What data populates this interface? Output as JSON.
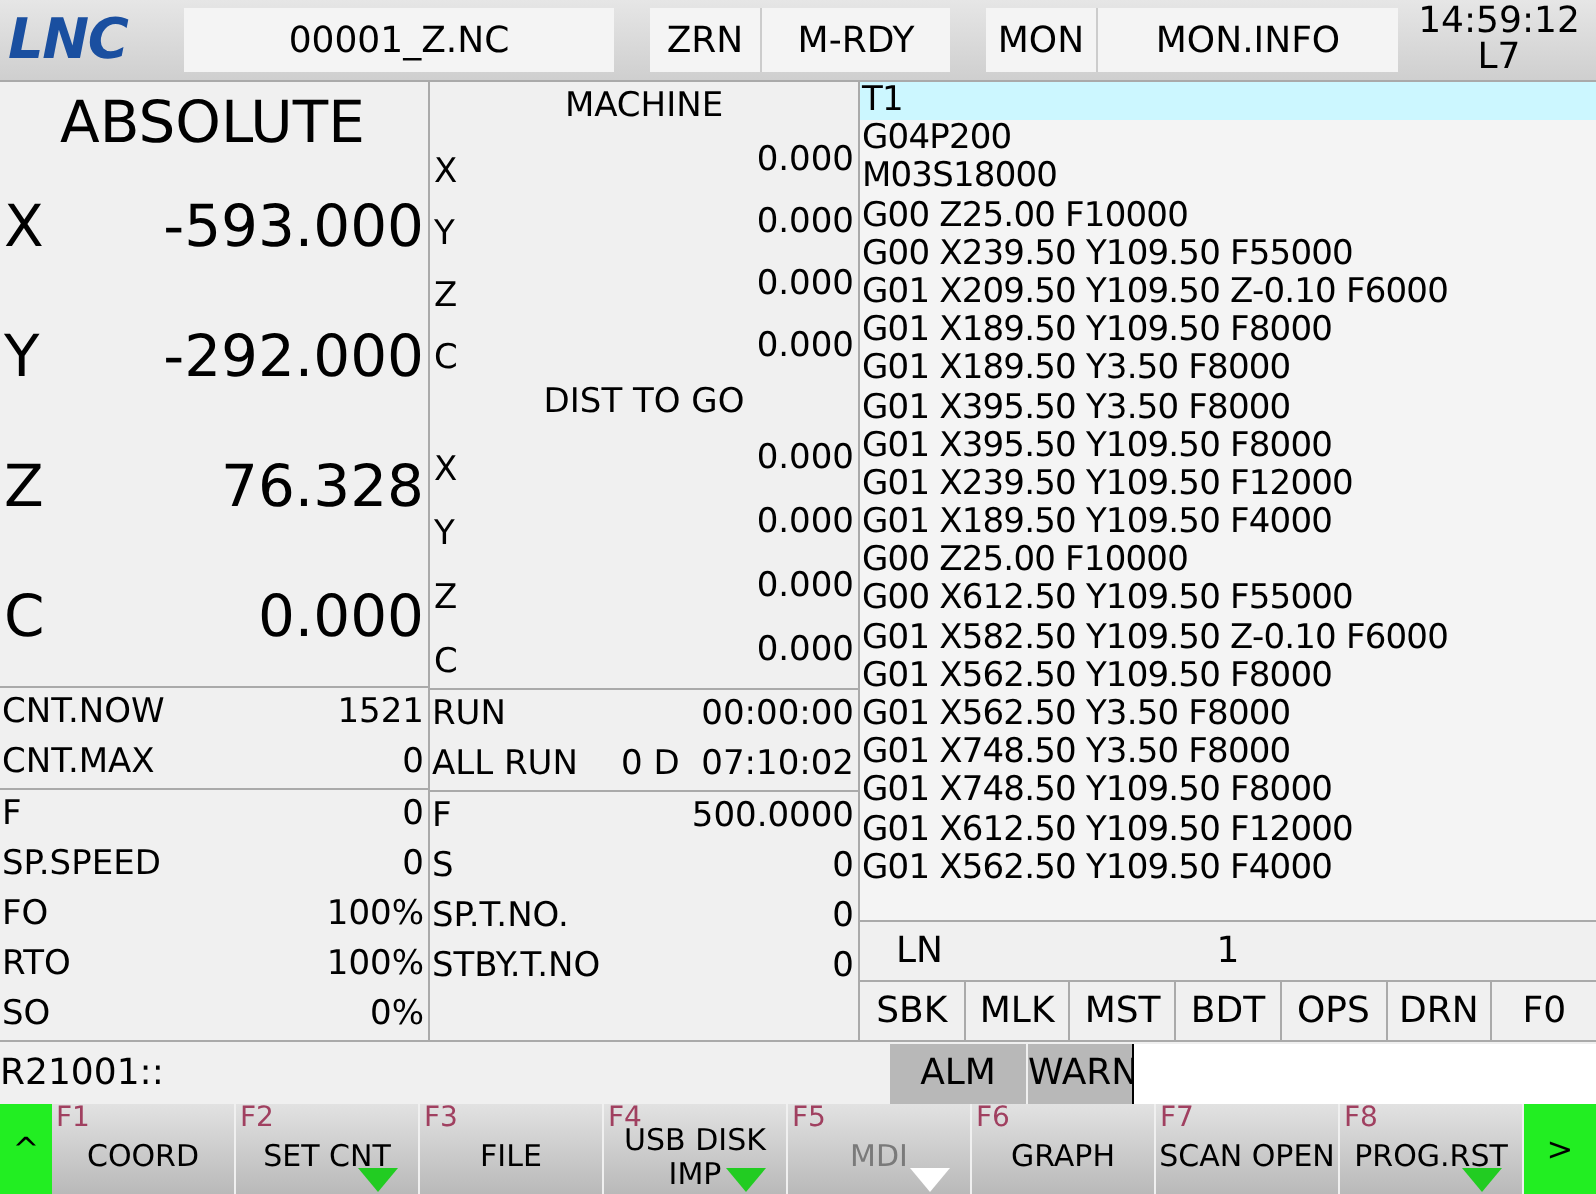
{
  "header": {
    "logo": "LNC",
    "file": "00001_Z.NC",
    "mode": [
      "ZRN",
      "M-RDY"
    ],
    "monitor": [
      "MON",
      "MON.INFO"
    ],
    "time": "14:59:12",
    "level": "L7"
  },
  "absolute": {
    "title": "ABSOLUTE",
    "axes": [
      {
        "name": "X",
        "value": "-593.000"
      },
      {
        "name": "Y",
        "value": "-292.000"
      },
      {
        "name": "Z",
        "value": "76.328"
      },
      {
        "name": "C",
        "value": "0.000"
      }
    ]
  },
  "machine": {
    "title": "MACHINE",
    "axes": [
      {
        "name": "X",
        "value": "0.000"
      },
      {
        "name": "Y",
        "value": "0.000"
      },
      {
        "name": "Z",
        "value": "0.000"
      },
      {
        "name": "C",
        "value": "0.000"
      }
    ]
  },
  "dist_to_go": {
    "title": "DIST TO GO",
    "axes": [
      {
        "name": "X",
        "value": "0.000"
      },
      {
        "name": "Y",
        "value": "0.000"
      },
      {
        "name": "Z",
        "value": "0.000"
      },
      {
        "name": "C",
        "value": "0.000"
      }
    ]
  },
  "left_stats": [
    [
      {
        "label": "CNT.NOW",
        "value": "1521"
      },
      {
        "label": "CNT.MAX",
        "value": "0"
      }
    ],
    [
      {
        "label": "F",
        "value": "0"
      },
      {
        "label": "SP.SPEED",
        "value": "0"
      },
      {
        "label": "FO",
        "value": "100%"
      },
      {
        "label": "RTO",
        "value": "100%"
      },
      {
        "label": "SO",
        "value": "0%"
      }
    ]
  ],
  "right_stats": [
    [
      {
        "label": "RUN",
        "value": "00:00:00"
      },
      {
        "label": "ALL RUN",
        "value": "0 D  07:10:02"
      }
    ],
    [
      {
        "label": "F",
        "value": "500.0000"
      },
      {
        "label": "S",
        "value": "0"
      },
      {
        "label": "SP.T.NO.",
        "value": "0"
      },
      {
        "label": "STBY.T.NO",
        "value": "0"
      }
    ]
  ],
  "program": [
    {
      "text": "T1",
      "selected": true
    },
    {
      "text": "G04P200",
      "selected": false
    },
    {
      "text": "M03S18000",
      "selected": false
    },
    {
      "text": "G00 Z25.00 F10000",
      "selected": false
    },
    {
      "text": "G00 X239.50 Y109.50 F55000",
      "selected": false
    },
    {
      "text": "G01 X209.50 Y109.50 Z-0.10 F6000",
      "selected": false
    },
    {
      "text": "G01 X189.50 Y109.50 F8000",
      "selected": false
    },
    {
      "text": "G01 X189.50 Y3.50 F8000",
      "selected": false
    },
    {
      "text": "G01 X395.50 Y3.50 F8000",
      "selected": false
    },
    {
      "text": "G01 X395.50 Y109.50 F8000",
      "selected": false
    },
    {
      "text": "G01 X239.50 Y109.50 F12000",
      "selected": false
    },
    {
      "text": "G01 X189.50 Y109.50 F4000",
      "selected": false
    },
    {
      "text": "G00 Z25.00 F10000",
      "selected": false
    },
    {
      "text": "G00 X612.50 Y109.50 F55000",
      "selected": false
    },
    {
      "text": "G01 X582.50 Y109.50 Z-0.10 F6000",
      "selected": false
    },
    {
      "text": "G01 X562.50 Y109.50 F8000",
      "selected": false
    },
    {
      "text": "G01 X562.50 Y3.50 F8000",
      "selected": false
    },
    {
      "text": "G01 X748.50 Y3.50 F8000",
      "selected": false
    },
    {
      "text": "G01 X748.50 Y109.50 F8000",
      "selected": false
    },
    {
      "text": "G01 X612.50 Y109.50 F12000",
      "selected": false
    },
    {
      "text": "G01 X562.50 Y109.50 F4000",
      "selected": false
    }
  ],
  "line_number": {
    "label": "LN",
    "value": "1"
  },
  "toggles": [
    "SBK",
    "MLK",
    "MST",
    "BDT",
    "OPS",
    "DRN",
    "F0"
  ],
  "command": {
    "text": "R21001::",
    "buttons": [
      "ALM",
      "WARN"
    ]
  },
  "softkeys": {
    "prev": "^",
    "next": ">",
    "keys": [
      {
        "fkey": "F1",
        "label": "COORD",
        "menu": false,
        "disabled": false
      },
      {
        "fkey": "F2",
        "label": "SET CNT",
        "menu": true,
        "disabled": false
      },
      {
        "fkey": "F3",
        "label": "FILE",
        "menu": false,
        "disabled": false
      },
      {
        "fkey": "F4",
        "label": "USB DISK IMP",
        "menu": true,
        "disabled": false
      },
      {
        "fkey": "F5",
        "label": "MDI",
        "menu": true,
        "disabled": true
      },
      {
        "fkey": "F6",
        "label": "GRAPH",
        "menu": false,
        "disabled": false
      },
      {
        "fkey": "F7",
        "label": "SCAN OPEN",
        "menu": false,
        "disabled": false
      },
      {
        "fkey": "F8",
        "label": "PROG.RST",
        "menu": true,
        "disabled": false
      }
    ]
  }
}
